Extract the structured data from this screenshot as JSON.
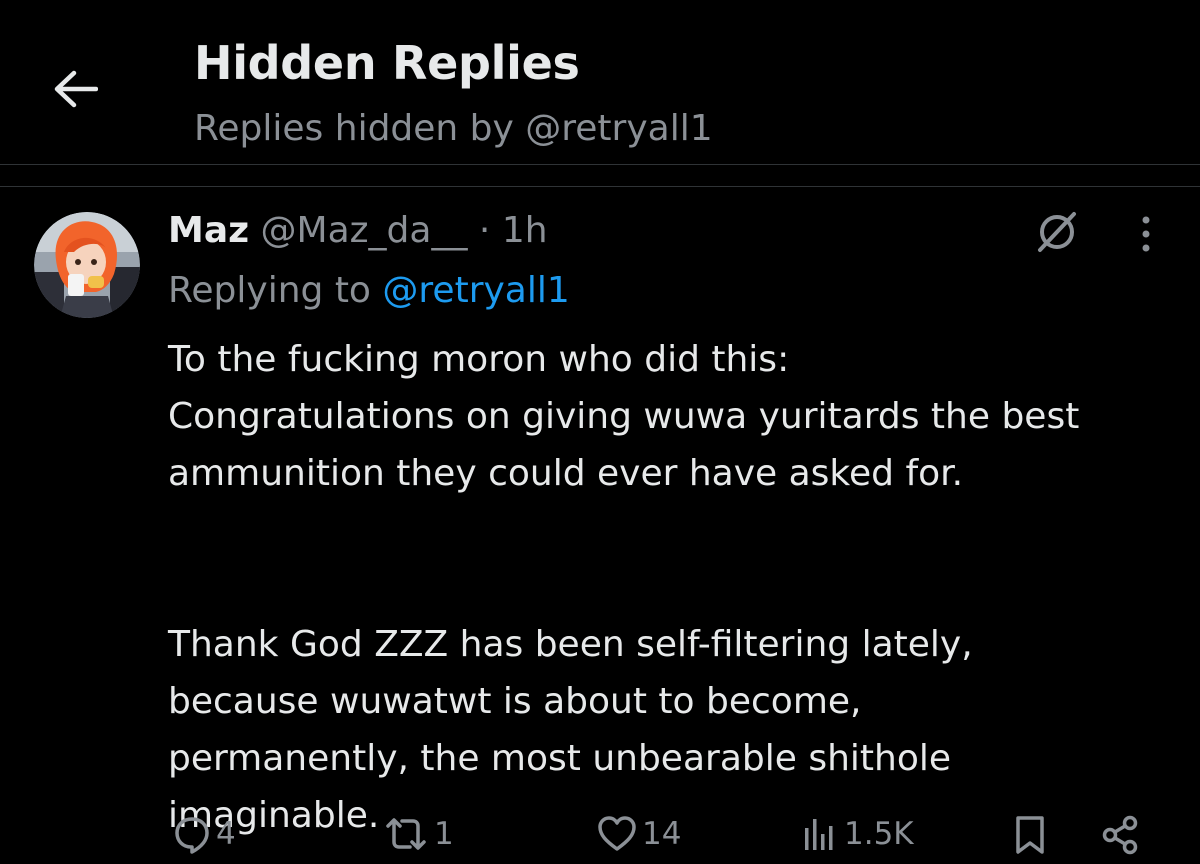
{
  "header": {
    "title": "Hidden Replies",
    "subtitle": "Replies hidden by @retryall1"
  },
  "tweet": {
    "display_name": "Maz",
    "handle": "@Maz_da__",
    "separator": "·",
    "time": "1h",
    "replying_prefix": "Replying to",
    "replying_to": "@retryall1",
    "body_lines": [
      "To the fucking moron who did this:",
      "Congratulations on giving wuwa yuritards the best",
      "ammunition they could ever have asked for.",
      "Thank God ZZZ has been self-filtering lately,",
      "because wuwatwt is about to become,",
      "permanently, the most unbearable shithole",
      "imaginable."
    ]
  },
  "actions": {
    "replies": "4",
    "reposts": "1",
    "likes": "14",
    "views": "1.5K"
  },
  "icons": {
    "back": "arrow-left-icon",
    "hide": "hidden-reply-icon",
    "more": "more-vertical-icon",
    "reply": "reply-icon",
    "repost": "repost-icon",
    "like": "heart-icon",
    "views": "analytics-icon",
    "bookmark": "bookmark-icon",
    "share": "share-icon"
  },
  "colors": {
    "background": "#000000",
    "text": "#e7e9ea",
    "muted": "#8b9096",
    "accent": "#1d9bf0",
    "divider": "#2f3336"
  }
}
